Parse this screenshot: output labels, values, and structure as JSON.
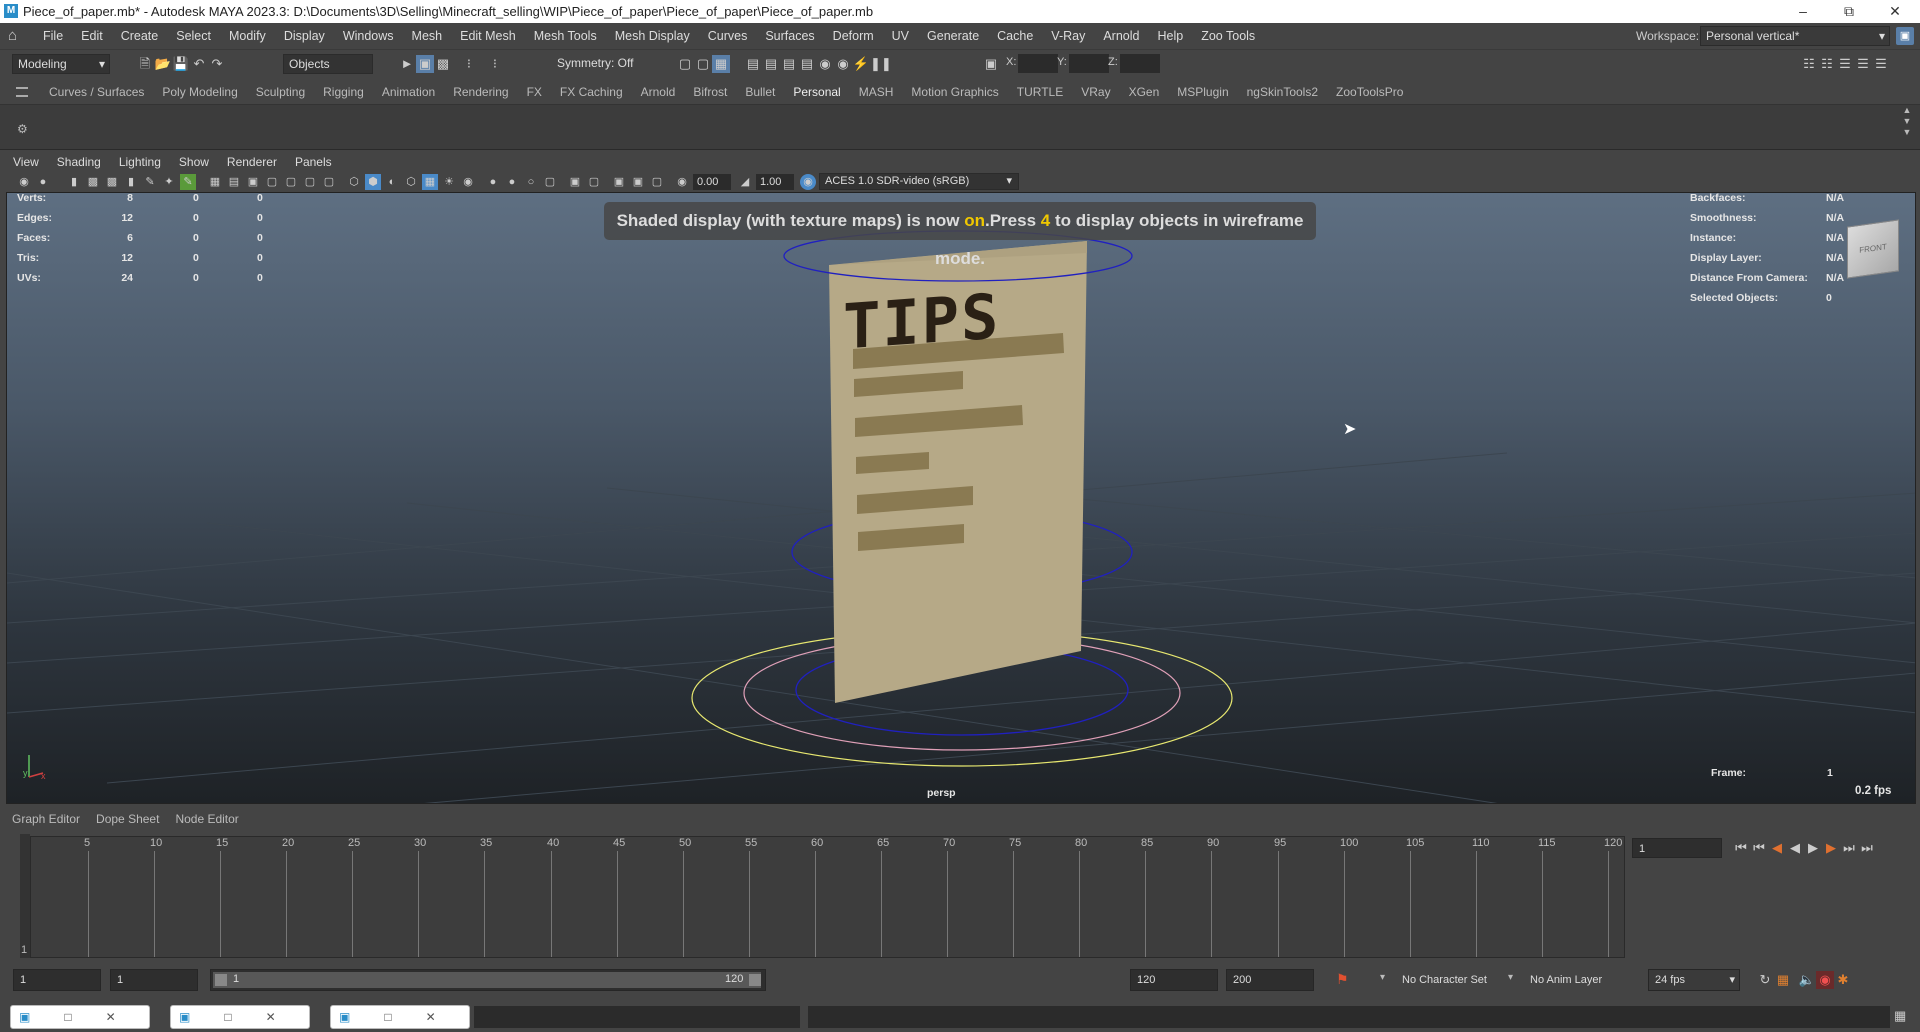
{
  "title": "Piece_of_paper.mb* - Autodesk MAYA 2023.3: D:\\Documents\\3D\\Selling\\Minecraft_selling\\WIP\\Piece_of_paper\\Piece_of_paper\\Piece_of_paper.mb",
  "menus": [
    "File",
    "Edit",
    "Create",
    "Select",
    "Modify",
    "Display",
    "Windows",
    "Mesh",
    "Edit Mesh",
    "Mesh Tools",
    "Mesh Display",
    "Curves",
    "Surfaces",
    "Deform",
    "UV",
    "Generate",
    "Cache",
    "V-Ray",
    "Arnold",
    "Help",
    "Zoo Tools"
  ],
  "workspace": {
    "label": "Workspace:",
    "value": "Personal vertical*"
  },
  "toolbar": {
    "mode": "Modeling",
    "objects": "Objects",
    "symmetry": "Symmetry: Off",
    "x_label": "X:",
    "y_label": "Y:",
    "z_label": "Z:"
  },
  "shelf_tabs": [
    "Curves / Surfaces",
    "Poly Modeling",
    "Sculpting",
    "Rigging",
    "Animation",
    "Rendering",
    "FX",
    "FX Caching",
    "Arnold",
    "Bifrost",
    "Bullet",
    "Personal",
    "MASH",
    "Motion Graphics",
    "TURTLE",
    "VRay",
    "XGen",
    "MSPlugin",
    "ngSkinTools2",
    "ZooToolsPro"
  ],
  "active_shelf": "Personal",
  "viewport_menus": [
    "View",
    "Shading",
    "Lighting",
    "Show",
    "Renderer",
    "Panels"
  ],
  "viewport_toolbar": {
    "exposure": "0.00",
    "gamma": "1.00",
    "colorspace": "ACES 1.0 SDR-video (sRGB)"
  },
  "hud_stats": [
    {
      "label": "Verts:",
      "v1": "8",
      "v2": "0",
      "v3": "0"
    },
    {
      "label": "Edges:",
      "v1": "12",
      "v2": "0",
      "v3": "0"
    },
    {
      "label": "Faces:",
      "v1": "6",
      "v2": "0",
      "v3": "0"
    },
    {
      "label": "Tris:",
      "v1": "12",
      "v2": "0",
      "v3": "0"
    },
    {
      "label": "UVs:",
      "v1": "24",
      "v2": "0",
      "v3": "0"
    }
  ],
  "hud_right": [
    {
      "label": "Backfaces:",
      "value": "N/A"
    },
    {
      "label": "Smoothness:",
      "value": "N/A"
    },
    {
      "label": "Instance:",
      "value": "N/A"
    },
    {
      "label": "Display Layer:",
      "value": "N/A"
    },
    {
      "label": "Distance From Camera:",
      "value": "N/A"
    },
    {
      "label": "Selected Objects:",
      "value": "0"
    }
  ],
  "hud_message": {
    "pre": "Shaded display (with texture maps) is now ",
    "on": "on",
    "mid": ".Press ",
    "key": "4",
    "post": " to display objects in wireframe mode."
  },
  "paper_text": "TIPS",
  "viewcube_label": "FRONT",
  "camera": "persp",
  "frame": {
    "label": "Frame:",
    "value": "1"
  },
  "fps_readout": "0.2 fps",
  "bottom_tabs": [
    "Graph Editor",
    "Dope Sheet",
    "Node Editor"
  ],
  "timeline_ticks": [
    "5",
    "10",
    "15",
    "20",
    "25",
    "30",
    "35",
    "40",
    "45",
    "50",
    "55",
    "60",
    "65",
    "70",
    "75",
    "80",
    "85",
    "90",
    "95",
    "100",
    "105",
    "110",
    "115",
    "120"
  ],
  "timeline_start_label": "1",
  "current_frame_field": "1",
  "range": {
    "start": "1",
    "inner_start": "1",
    "slider_start": "1",
    "slider_end": "120",
    "inner_end": "120",
    "end": "200"
  },
  "char_set": "No Character Set",
  "anim_layer": "No Anim Layer",
  "fps": "24 fps"
}
